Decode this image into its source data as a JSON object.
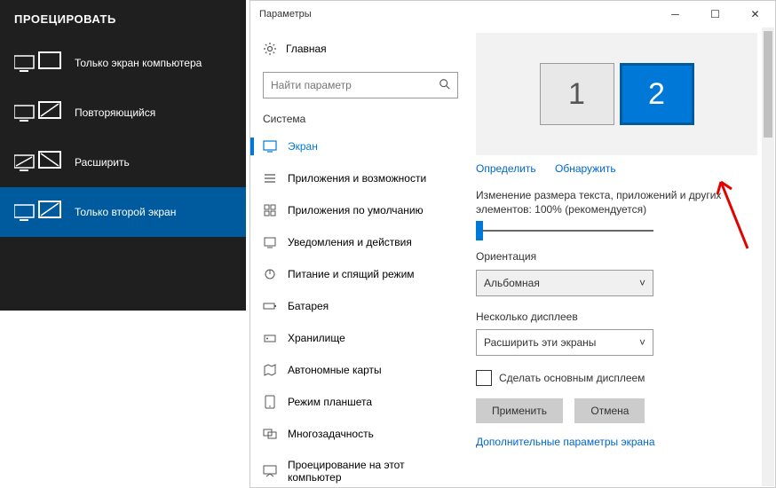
{
  "project": {
    "title": "ПРОЕЦИРОВАТЬ",
    "items": [
      {
        "label": "Только экран компьютера"
      },
      {
        "label": "Повторяющийся"
      },
      {
        "label": "Расширить"
      },
      {
        "label": "Только второй экран"
      }
    ],
    "selected": 3
  },
  "window": {
    "title": "Параметры"
  },
  "nav": {
    "home": "Главная",
    "search_placeholder": "Найти параметр",
    "section": "Система",
    "items": [
      {
        "label": "Экран"
      },
      {
        "label": "Приложения и возможности"
      },
      {
        "label": "Приложения по умолчанию"
      },
      {
        "label": "Уведомления и действия"
      },
      {
        "label": "Питание и спящий режим"
      },
      {
        "label": "Батарея"
      },
      {
        "label": "Хранилище"
      },
      {
        "label": "Автономные карты"
      },
      {
        "label": "Режим планшета"
      },
      {
        "label": "Многозадачность"
      },
      {
        "label": "Проецирование на этот компьютер"
      }
    ],
    "active": 0
  },
  "display": {
    "monitors": [
      "1",
      "2"
    ],
    "identify": "Определить",
    "detect": "Обнаружить",
    "scale_label": "Изменение размера текста, приложений и других элементов: 100% (рекомендуется)",
    "orientation_label": "Ориентация",
    "orientation_value": "Альбомная",
    "multiple_label": "Несколько дисплеев",
    "multiple_value": "Расширить эти экраны",
    "make_main": "Сделать основным дисплеем",
    "apply": "Применить",
    "cancel": "Отмена",
    "advanced": "Дополнительные параметры экрана"
  }
}
